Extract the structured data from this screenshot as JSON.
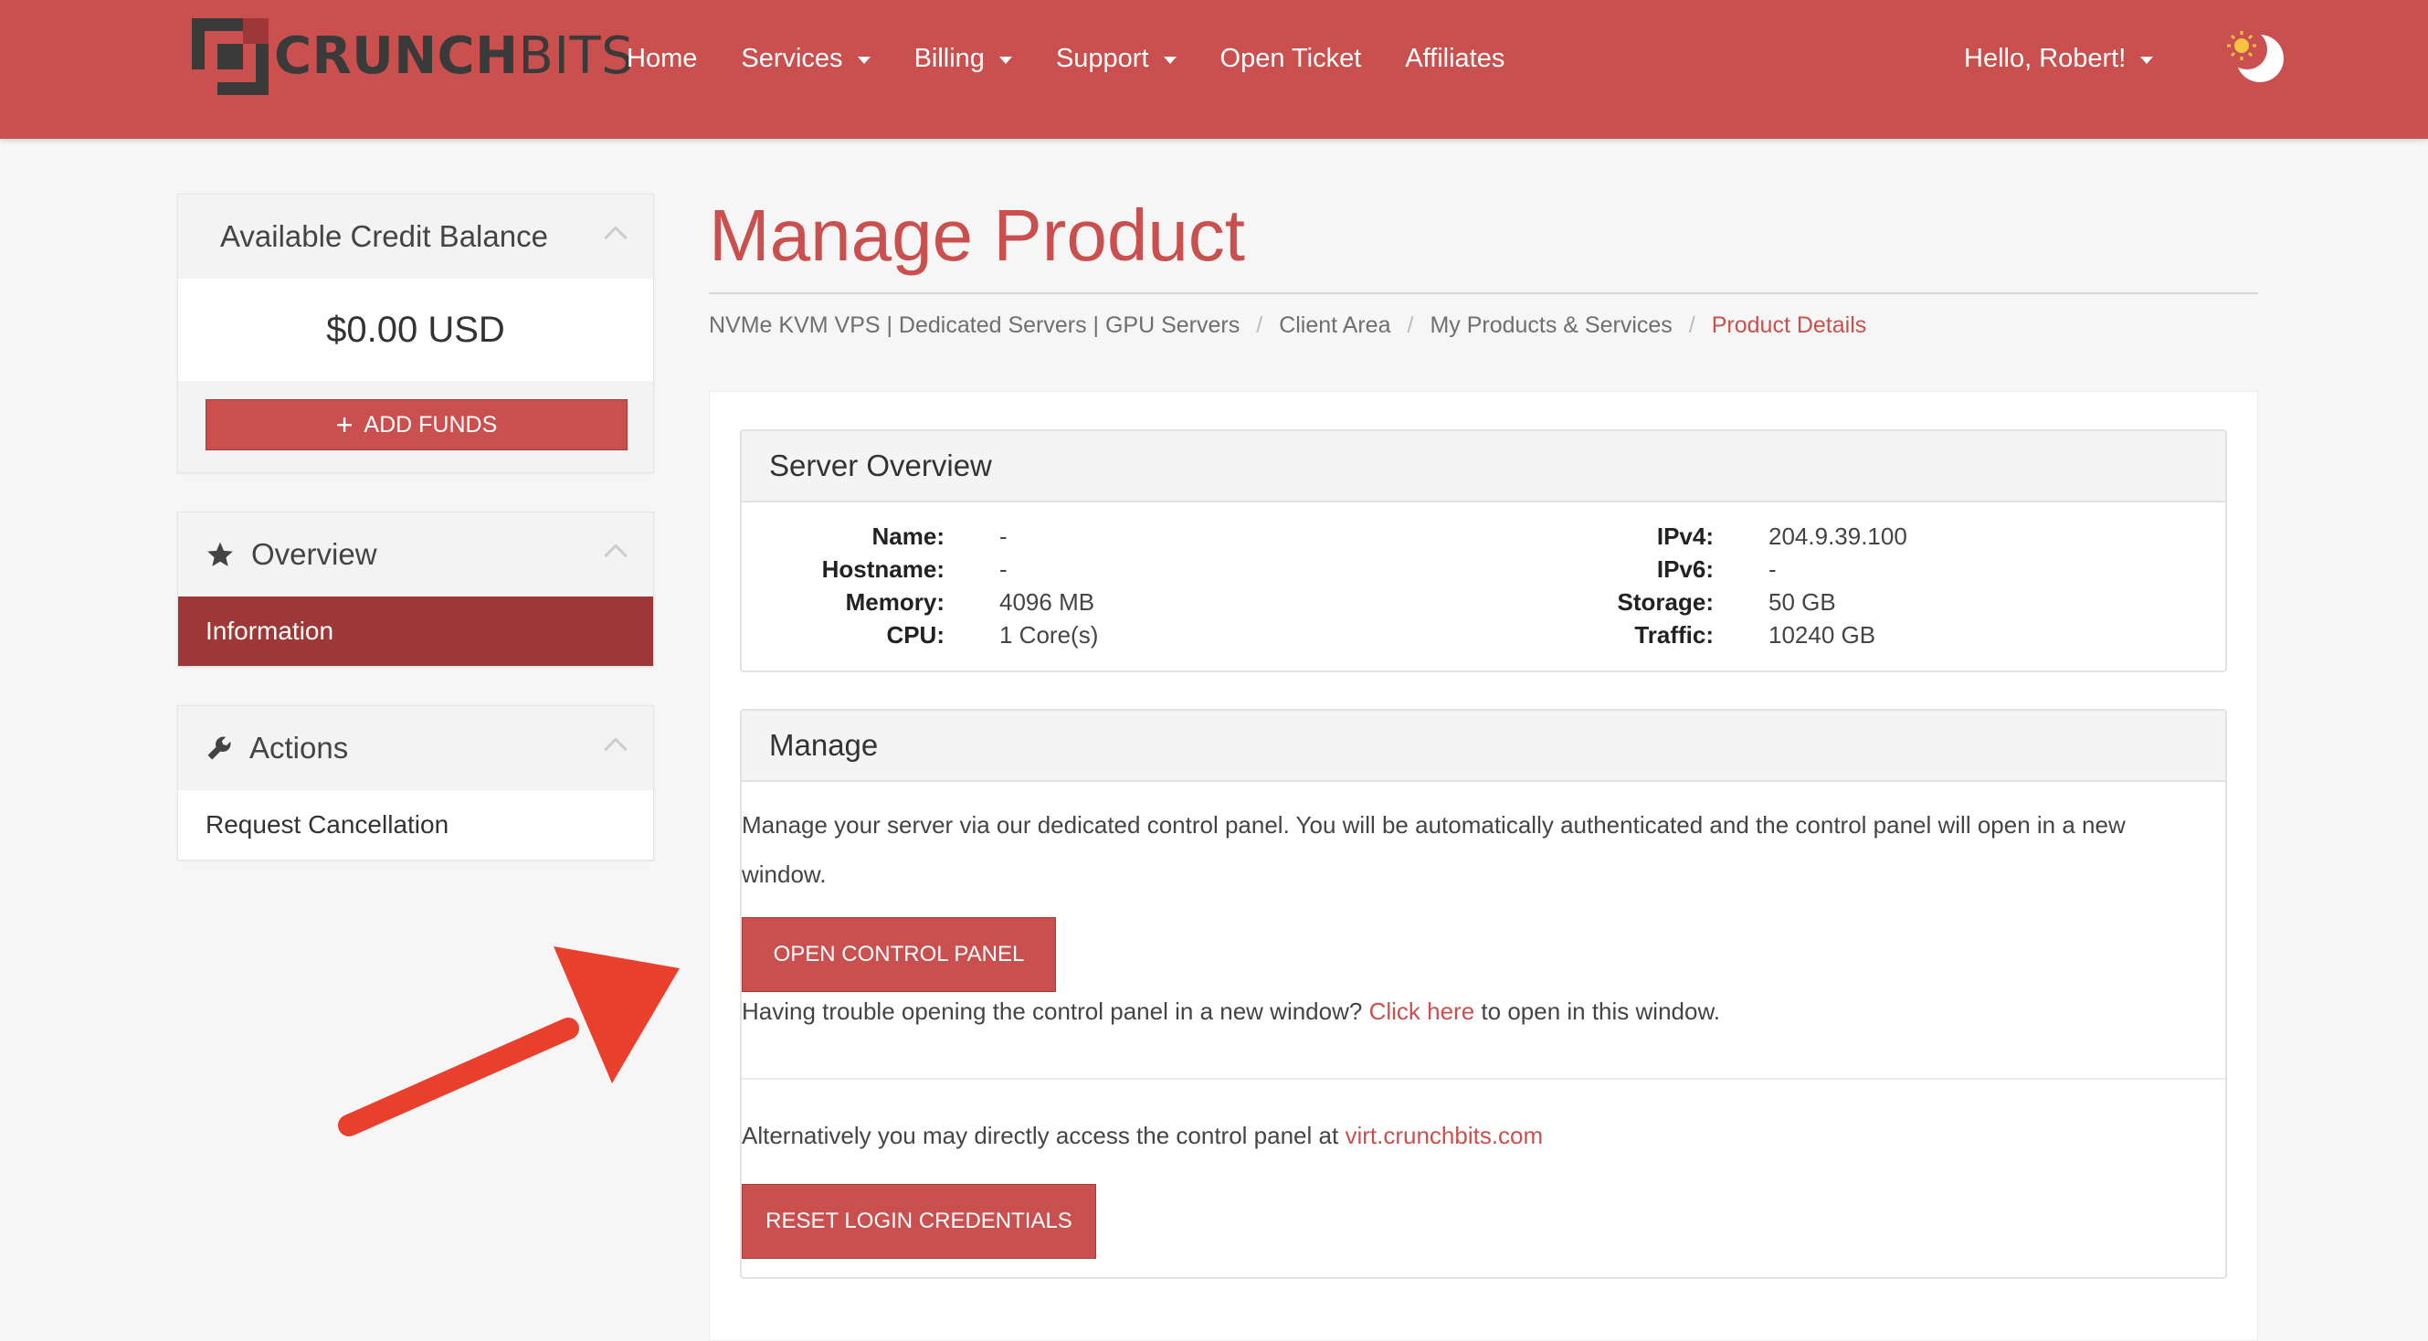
{
  "brand": {
    "part1": "CRUNCH",
    "part2": "BITS"
  },
  "nav": {
    "items": [
      {
        "label": "Home",
        "dropdown": false
      },
      {
        "label": "Services",
        "dropdown": true
      },
      {
        "label": "Billing",
        "dropdown": true
      },
      {
        "label": "Support",
        "dropdown": true
      },
      {
        "label": "Open Ticket",
        "dropdown": false
      },
      {
        "label": "Affiliates",
        "dropdown": false
      }
    ],
    "user_greeting": "Hello, Robert!",
    "theme_icon": "sun-moon-icon"
  },
  "sidebar": {
    "credit": {
      "title": "Available Credit Balance",
      "amount": "$0.00 USD",
      "add_funds_label": "ADD FUNDS"
    },
    "overview": {
      "title": "Overview",
      "items": [
        "Information"
      ]
    },
    "actions": {
      "title": "Actions",
      "items": [
        "Request Cancellation"
      ]
    }
  },
  "page": {
    "title": "Manage Product",
    "breadcrumb": [
      "NVMe KVM VPS | Dedicated Servers | GPU Servers",
      "Client Area",
      "My Products & Services",
      "Product Details"
    ]
  },
  "server_overview": {
    "title": "Server Overview",
    "left": [
      {
        "label": "Name:",
        "value": "-"
      },
      {
        "label": "Hostname:",
        "value": "-"
      },
      {
        "label": "Memory:",
        "value": "4096 MB"
      },
      {
        "label": "CPU:",
        "value": "1 Core(s)"
      }
    ],
    "right": [
      {
        "label": "IPv4:",
        "value": "204.9.39.100"
      },
      {
        "label": "IPv6:",
        "value": "-"
      },
      {
        "label": "Storage:",
        "value": "50 GB"
      },
      {
        "label": "Traffic:",
        "value": "10240 GB"
      }
    ]
  },
  "manage": {
    "title": "Manage",
    "description": "Manage your server via our dedicated control panel. You will be automatically authenticated and the control panel will open in a new window.",
    "open_panel_label": "OPEN CONTROL PANEL",
    "trouble_prefix": "Having trouble opening the control panel in a new window?",
    "trouble_link": "Click here",
    "trouble_suffix": "to open in this window.",
    "alt_prefix": "Alternatively you may directly access the control panel at",
    "alt_link": "virt.crunchbits.com",
    "reset_label": "RESET LOGIN CREDENTIALS"
  },
  "colors": {
    "brand_red": "#c9504e",
    "active_red": "#9e3838",
    "arrow": "#e8402c"
  }
}
